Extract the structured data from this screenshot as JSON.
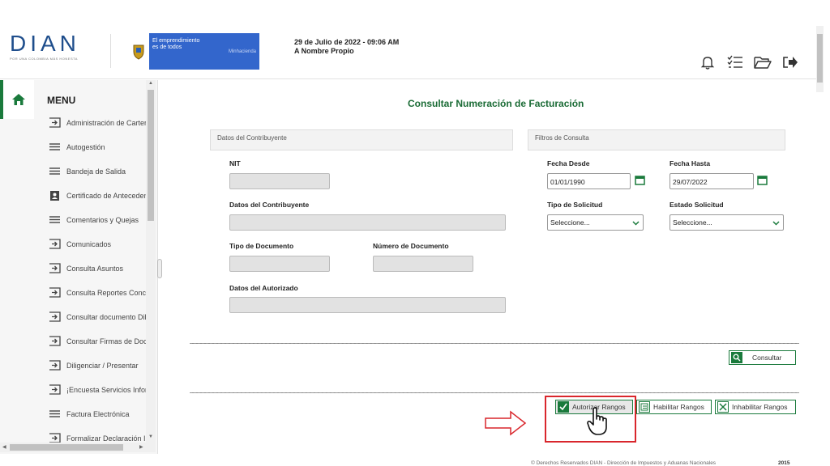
{
  "header": {
    "logo_text": "DIAN",
    "logo_tagline": "POR UNA COLOMBIA MÁS HONESTA",
    "gov_slogan_line1": "El emprendimiento",
    "gov_slogan_line2": "es de todos",
    "gov_ministry": "Minhacienda",
    "date": "29 de Julio de 2022 - 09:06 AM",
    "user": "A Nombre Propio",
    "icons": [
      "bell-icon",
      "checklist-icon",
      "folder-open-icon",
      "logout-icon"
    ]
  },
  "sidebar": {
    "menu_title": "MENU",
    "items": [
      {
        "label": "Administración de Carter",
        "icon": "arrow-box-icon"
      },
      {
        "label": "Autogestión",
        "icon": "hamburger-icon"
      },
      {
        "label": "Bandeja de Salida",
        "icon": "hamburger-icon"
      },
      {
        "label": "Certificado de Anteceden",
        "icon": "clipboard-user-icon"
      },
      {
        "label": "Comentarios y Quejas",
        "icon": "hamburger-icon"
      },
      {
        "label": "Comunicados",
        "icon": "arrow-box-icon"
      },
      {
        "label": "Consulta Asuntos",
        "icon": "arrow-box-icon"
      },
      {
        "label": "Consulta Reportes Conc",
        "icon": "arrow-box-icon"
      },
      {
        "label": "Consultar documento Dil",
        "icon": "arrow-box-icon"
      },
      {
        "label": "Consultar Firmas de Doc",
        "icon": "arrow-box-icon"
      },
      {
        "label": "Diligenciar / Presentar",
        "icon": "arrow-box-icon"
      },
      {
        "label": "¡Encuesta Servicios Infor",
        "icon": "arrow-box-icon"
      },
      {
        "label": "Factura Electrónica",
        "icon": "hamburger-icon"
      },
      {
        "label": "Formalizar Declaración I",
        "icon": "arrow-box-icon"
      }
    ]
  },
  "main": {
    "title": "Consultar Numeración de Facturación",
    "section_contribuyente": "Datos del Contribuyente",
    "section_filtros": "Filtros de Consulta",
    "labels": {
      "nit": "NIT",
      "datos_contribuyente": "Datos del Contribuyente",
      "tipo_documento": "Tipo de Documento",
      "numero_documento": "Número de Documento",
      "datos_autorizado": "Datos del Autorizado",
      "fecha_desde": "Fecha Desde",
      "fecha_hasta": "Fecha Hasta",
      "tipo_solicitud": "Tipo de Solicitud",
      "estado_solicitud": "Estado Solicitud"
    },
    "values": {
      "fecha_desde": "01/01/1990",
      "fecha_hasta": "29/07/2022",
      "tipo_solicitud": "Seleccione...",
      "estado_solicitud": "Seleccione..."
    },
    "buttons": {
      "consultar": "Consultar",
      "autorizar": "Autorizar Rangos",
      "habilitar": "Habilitar Rangos",
      "inhabilitar": "Inhabilitar Rangos"
    }
  },
  "footer": {
    "text": "© Derechos Reservados DIAN - Dirección de Impuestos y Aduanas Nacionales",
    "year": "2015"
  },
  "colors": {
    "accent_green": "#1a7a3c",
    "title_green": "#1a6b35",
    "highlight_red": "#d9262c",
    "gov_blue": "#3366cc"
  }
}
